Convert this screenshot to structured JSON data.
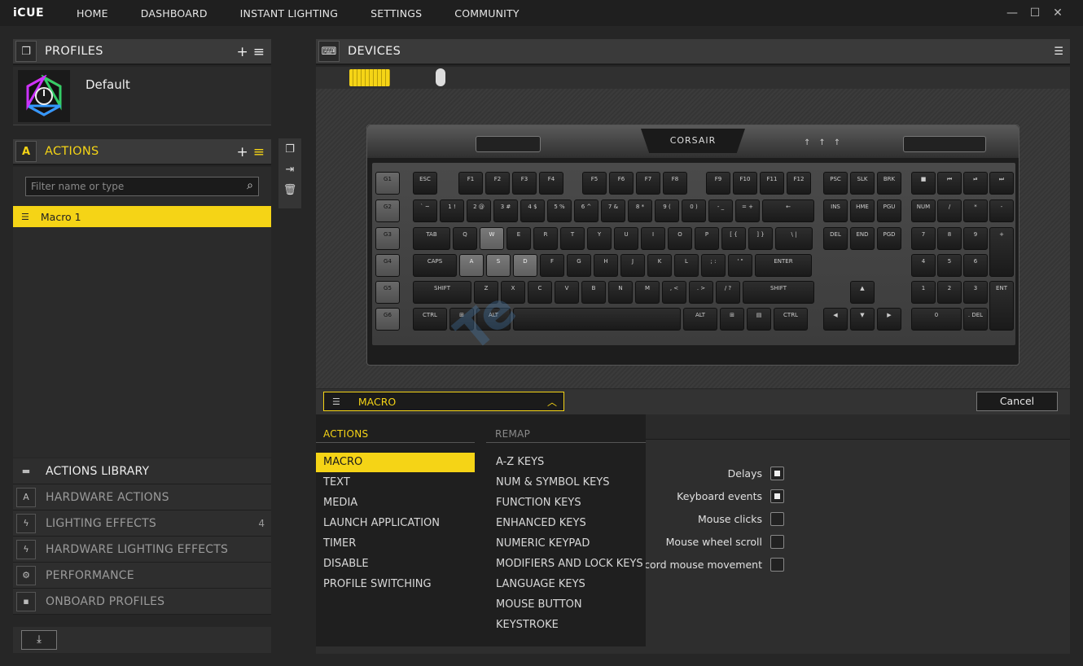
{
  "app": {
    "brand": "iCUE",
    "nav": [
      "HOME",
      "DASHBOARD",
      "INSTANT LIGHTING",
      "SETTINGS",
      "COMMUNITY"
    ],
    "window_controls": [
      "minimize-icon",
      "maximize-icon",
      "close-icon"
    ]
  },
  "profiles": {
    "title": "PROFILES",
    "add_icon": "plus-icon",
    "menu_icon": "hamburger-icon",
    "current": "Default"
  },
  "actions": {
    "title": "ACTIONS",
    "filter_placeholder": "Filter name or type",
    "items": [
      "Macro 1"
    ],
    "accent": "#f5d416"
  },
  "library": {
    "title": "ACTIONS LIBRARY",
    "items": [
      {
        "label": "HARDWARE ACTIONS",
        "count": ""
      },
      {
        "label": "LIGHTING EFFECTS",
        "count": "4"
      },
      {
        "label": "HARDWARE LIGHTING EFFECTS",
        "count": ""
      },
      {
        "label": "PERFORMANCE",
        "count": ""
      },
      {
        "label": "ONBOARD PROFILES",
        "count": ""
      }
    ]
  },
  "devices": {
    "title": "DEVICES",
    "logo_text": "CORSAIR",
    "watermark": "Te"
  },
  "remap": {
    "dropdown_value": "MACRO",
    "cancel_label": "Cancel",
    "actions_header": "ACTIONS",
    "remap_header": "REMAP",
    "action_items": [
      "MACRO",
      "TEXT",
      "MEDIA",
      "LAUNCH APPLICATION",
      "TIMER",
      "DISABLE",
      "PROFILE SWITCHING"
    ],
    "remap_items": [
      "A-Z KEYS",
      "NUM & SYMBOL KEYS",
      "FUNCTION KEYS",
      "ENHANCED KEYS",
      "NUMERIC KEYPAD",
      "MODIFIERS AND LOCK KEYS",
      "LANGUAGE KEYS",
      "MOUSE BUTTON",
      "KEYSTROKE"
    ],
    "options": [
      {
        "label": "Delays",
        "checked": true
      },
      {
        "label": "Keyboard events",
        "checked": true
      },
      {
        "label": "Mouse clicks",
        "checked": false
      },
      {
        "label": "Mouse wheel scroll",
        "checked": false
      },
      {
        "label": "Record mouse movement",
        "checked": false
      }
    ]
  },
  "keyboard": {
    "rows": [
      [
        "G1",
        "ESC",
        "F1",
        "F2",
        "F3",
        "F4",
        "F5",
        "F6",
        "F7",
        "F8",
        "F9",
        "F10",
        "F11",
        "F12",
        "PSC",
        "SLK",
        "BRK",
        "■",
        "⏮",
        "⏯",
        "⏭"
      ],
      [
        "G2",
        "` ~",
        "1 !",
        "2 @",
        "3 #",
        "4 $",
        "5 %",
        "6 ^",
        "7 &",
        "8 *",
        "9 (",
        "0 )",
        "- _",
        "= +",
        "←",
        "INS",
        "HME",
        "PGU",
        "NUM",
        "/",
        "*",
        "-"
      ],
      [
        "G3",
        "TAB",
        "Q",
        "W",
        "E",
        "R",
        "T",
        "Y",
        "U",
        "I",
        "O",
        "P",
        "[ {",
        "] }",
        "\\ |",
        "DEL",
        "END",
        "PGD",
        "7",
        "8",
        "9",
        "+"
      ],
      [
        "G4",
        "CAPS",
        "A",
        "S",
        "D",
        "F",
        "G",
        "H",
        "J",
        "K",
        "L",
        "; :",
        "' \"",
        "ENTER",
        "4",
        "5",
        "6"
      ],
      [
        "G5",
        "SHIFT",
        "Z",
        "X",
        "C",
        "V",
        "B",
        "N",
        "M",
        ", <",
        ". >",
        "/ ?",
        "SHIFT",
        "▲",
        "1",
        "2",
        "3",
        "ENT"
      ],
      [
        "G6",
        "CTRL",
        "⊞",
        "ALT",
        "",
        "ALT",
        "⊞",
        "▤",
        "CTRL",
        "◀",
        "▼",
        "▶",
        "0",
        ". DEL"
      ]
    ],
    "highlighted": [
      "W",
      "A",
      "S",
      "D"
    ]
  }
}
